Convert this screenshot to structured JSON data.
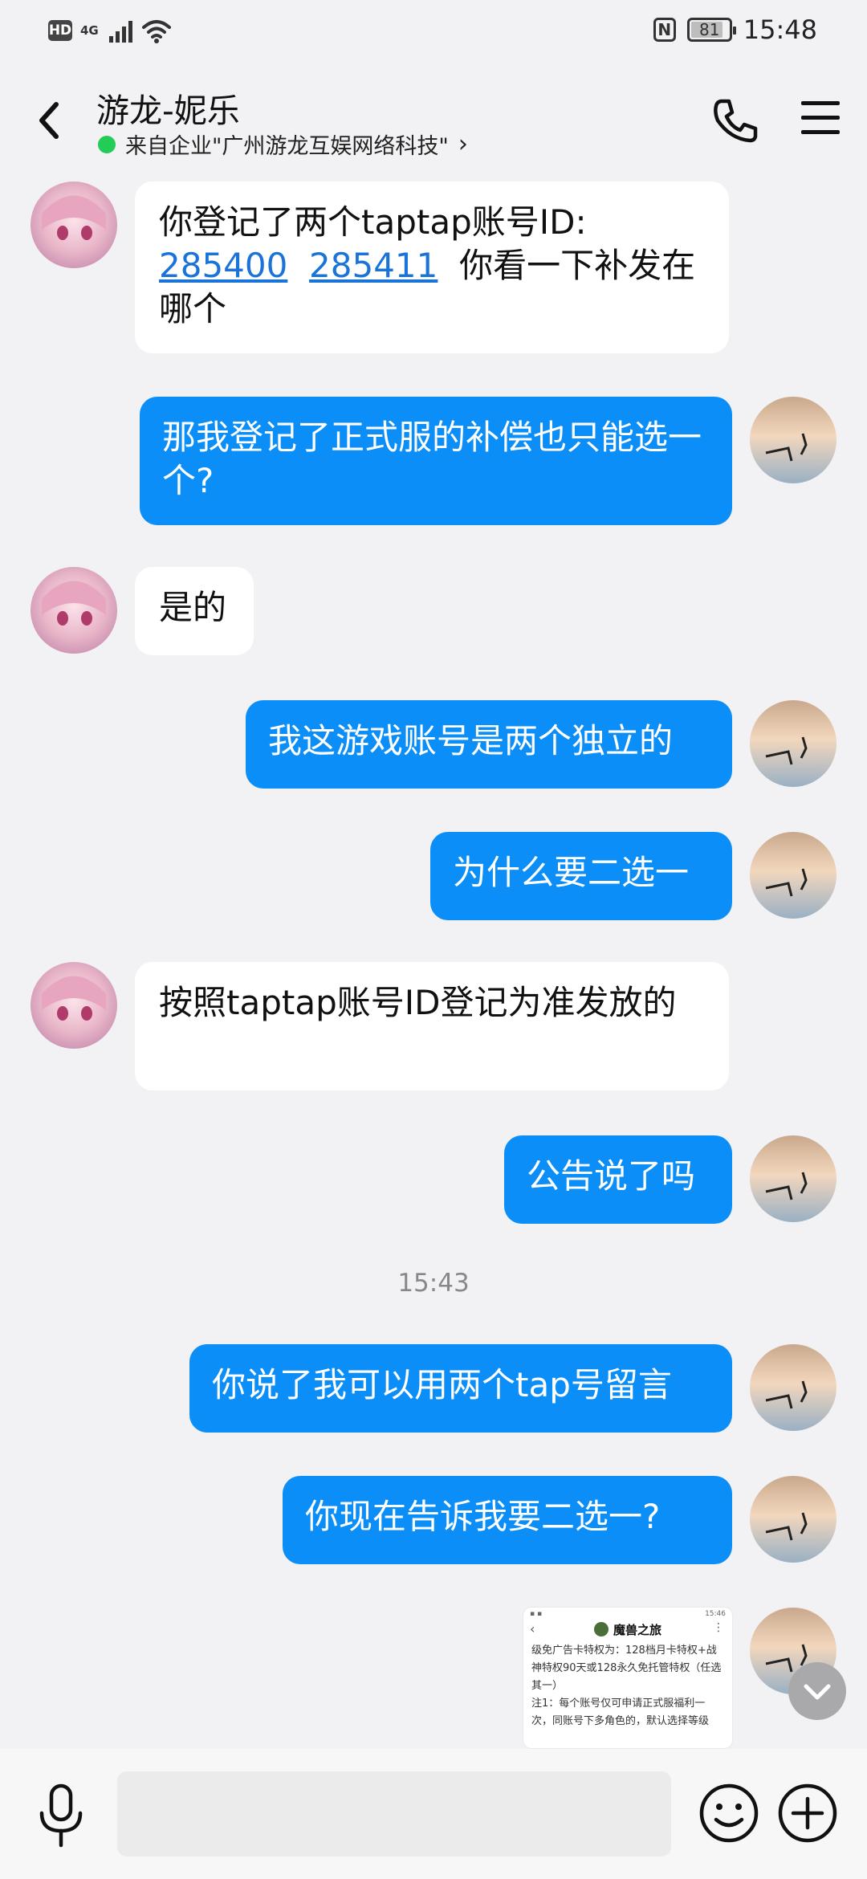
{
  "status_bar": {
    "hd": "HD",
    "network": "4G",
    "battery": "81",
    "time": "15:48"
  },
  "header": {
    "title": "游龙-妮乐",
    "subtitle": "来自企业\"广州游龙互娱网络科技\"",
    "subtitle_chevron": "›"
  },
  "messages": [
    {
      "side": "in",
      "text_prefix": "你登记了两个taptap账号ID:",
      "link1": "285400",
      "link2": "285411",
      "text_suffix": "你看一下补发在哪个"
    },
    {
      "side": "out",
      "text": "那我登记了正式服的补偿也只能选一个?"
    },
    {
      "side": "in",
      "text": "是的"
    },
    {
      "side": "out",
      "text": "我这游戏账号是两个独立的"
    },
    {
      "side": "out",
      "text": "为什么要二选一"
    },
    {
      "side": "in",
      "text": "按照taptap账号ID登记为准发放的"
    },
    {
      "side": "out",
      "text": "公告说了吗"
    },
    {
      "side": "out",
      "text": "你说了我可以用两个tap号留言"
    },
    {
      "side": "out",
      "text": "你现在告诉我要二选一?"
    }
  ],
  "timestamp": "15:43",
  "image_preview": {
    "status_time": "15:46",
    "app_title": "魔兽之旅",
    "lines": [
      "级免广告卡特权为：128档月卡特权+战",
      "神特权90天或128永久免托管特权（任选",
      "其一）",
      "注1：每个账号仅可申请正式服福利一",
      "次，同账号下多角色的，默认选择等级"
    ]
  },
  "input": {
    "placeholder": ""
  },
  "colors": {
    "outgoing_bubble": "#0b8ef7",
    "incoming_bubble": "#ffffff",
    "link": "#1a73d9",
    "online_dot": "#22cc55",
    "background": "#f2f2f4"
  }
}
